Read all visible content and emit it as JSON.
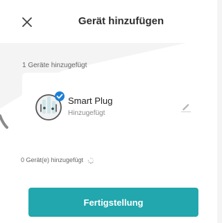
{
  "header": {
    "title": "Gerät hinzufügen",
    "close_icon": "close-icon"
  },
  "devices_summary": {
    "count_label": "1 Geräte hinzugefügt"
  },
  "device_card": {
    "name": "Smart Plug",
    "status": "Hinzugefügt",
    "icon": "smart-plug-icon",
    "badge_icon": "checkmark-icon",
    "edit_icon": "pencil-icon"
  },
  "added_counter": {
    "label": "0 Gerät(e) hinzugefügt",
    "loading_icon": "loading-spinner-icon"
  },
  "actions": {
    "finish_label": "Fertigstellung"
  },
  "colors": {
    "accent": "#21a7ad",
    "check_badge": "#1c7fd6",
    "background": "#f4f4f4",
    "card": "#ffffff"
  }
}
